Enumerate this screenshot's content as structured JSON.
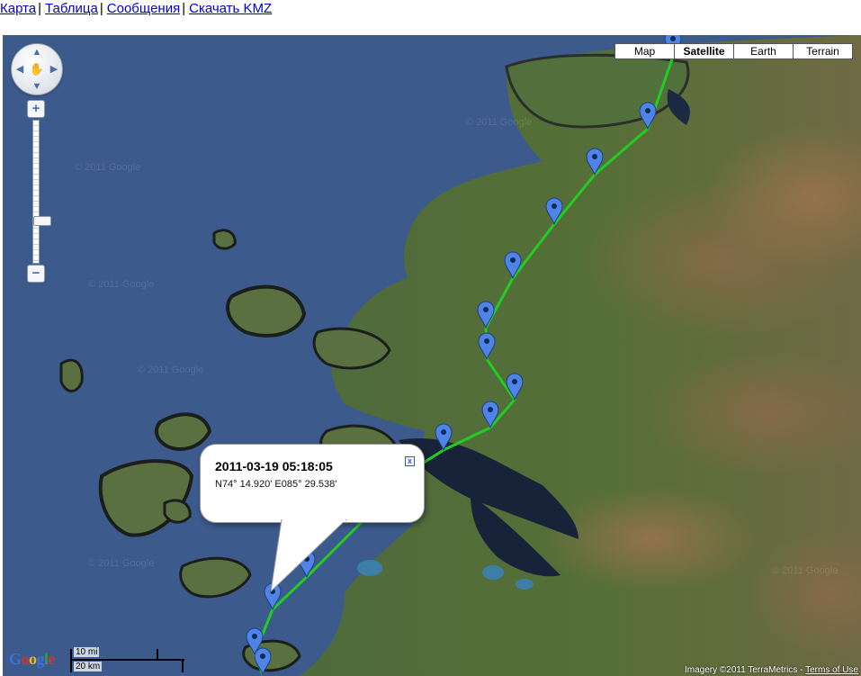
{
  "nav": {
    "map_link": "Карта",
    "table_link": "Таблица",
    "messages_link": "Сообщения",
    "download_link": "Скачать KMZ",
    "separator": "|"
  },
  "map_types": [
    "Map",
    "Satellite",
    "Earth",
    "Terrain"
  ],
  "active_map_type": "Satellite",
  "zoom": {
    "plus": "+",
    "minus": "−"
  },
  "infowindow": {
    "title": "2011-03-19 05:18:05",
    "coords": "N74° 14.920' E085° 29.538'",
    "close_label": "x"
  },
  "scale": {
    "imperial": "10 mi",
    "metric": "20 km"
  },
  "logo": {
    "letters": [
      "G",
      "o",
      "o",
      "g",
      "l",
      "e"
    ]
  },
  "watermark_text": "© 2011 Google",
  "copyright": {
    "text": "Imagery ©2011 TerraMetrics -",
    "terms_link": "Terms of Use"
  },
  "colors": {
    "track": "#22cc22",
    "marker": "#4f83e6",
    "marker_dot": "#0a2b5a",
    "water": "#3c5a8c",
    "link": "#0000cc",
    "logo": [
      "#3b6fe0",
      "#d0362a",
      "#f2b70f",
      "#3b6fe0",
      "#2f9e3f",
      "#d0362a"
    ]
  }
}
